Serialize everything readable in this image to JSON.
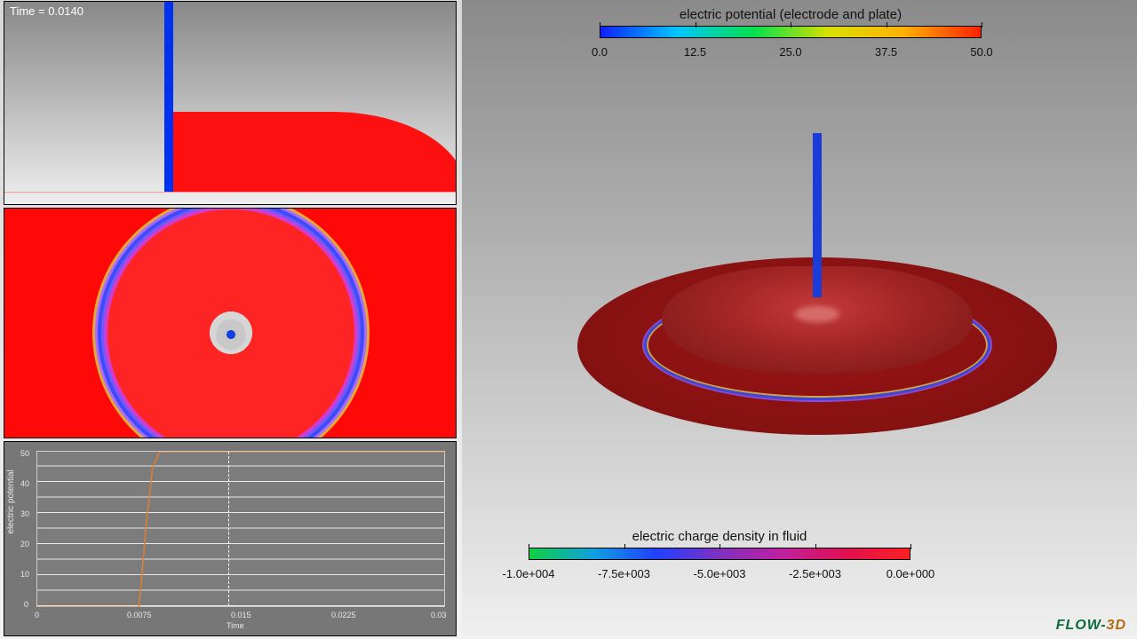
{
  "time": {
    "label": "Time = 0.0140",
    "value": 0.014
  },
  "legends": {
    "potential": {
      "title": "electric potential (electrode and plate)",
      "ticks": [
        "0.0",
        "12.5",
        "25.0",
        "37.5",
        "50.0"
      ]
    },
    "charge": {
      "title": "electric charge density in fluid",
      "ticks": [
        "-1.0e+004",
        "-7.5e+003",
        "-5.0e+003",
        "-2.5e+003",
        "0.0e+000"
      ]
    }
  },
  "chart_data": {
    "type": "line",
    "title": "",
    "xlabel": "Time",
    "ylabel": "electric potential",
    "xlim": [
      0,
      0.03
    ],
    "ylim": [
      0,
      50
    ],
    "xticks": [
      "0",
      "0.0075",
      "0.015",
      "0.0225",
      "0.03"
    ],
    "yticks": [
      "0",
      "10",
      "20",
      "30",
      "40",
      "50"
    ],
    "cursor_x": 0.014,
    "series": [
      {
        "name": "electric potential",
        "x": [
          0.0,
          0.0075,
          0.008,
          0.0085,
          0.009,
          0.03
        ],
        "y": [
          0,
          0,
          25,
          45,
          50,
          50
        ]
      }
    ]
  },
  "logo": {
    "part1": "FLOW-",
    "part2": "3D"
  }
}
